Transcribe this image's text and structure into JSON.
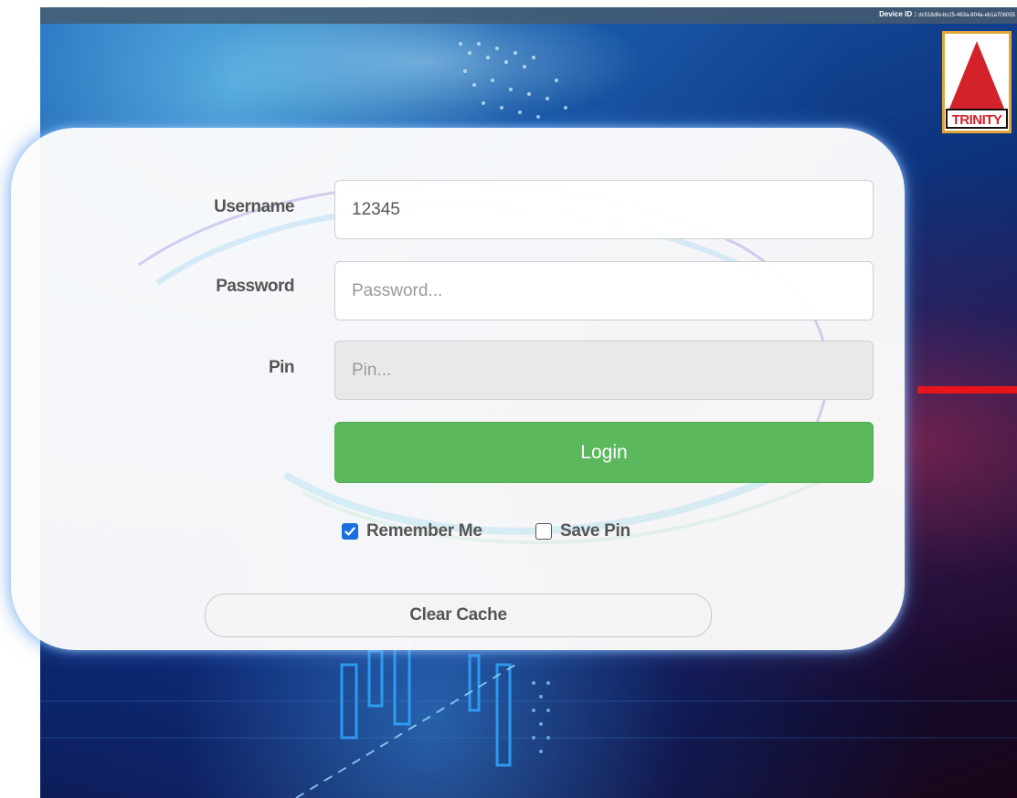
{
  "header": {
    "device_id_label": "Device ID :",
    "device_id_value": "dc518dfe-bc25-463a-804a-eb1a706055"
  },
  "brand": {
    "logo_text": "TRINITY",
    "logo_red": "#d3222a",
    "logo_frame": "#e1a63a"
  },
  "login_form": {
    "username": {
      "label": "Username",
      "value": "12345",
      "placeholder": ""
    },
    "password": {
      "label": "Password",
      "value": "",
      "placeholder": "Password..."
    },
    "pin": {
      "label": "Pin",
      "value": "",
      "placeholder": "Pin...",
      "disabled": true
    },
    "login_button": "Login",
    "remember_me": {
      "label": "Remember Me",
      "checked": true
    },
    "save_pin": {
      "label": "Save Pin",
      "checked": false
    },
    "clear_cache_button": "Clear Cache"
  },
  "colors": {
    "login_button": "#5cb85c",
    "checkbox_checked": "#1a6fe0",
    "accent_line": "#e8141c"
  },
  "icons": {
    "checkmark": "check-icon"
  }
}
